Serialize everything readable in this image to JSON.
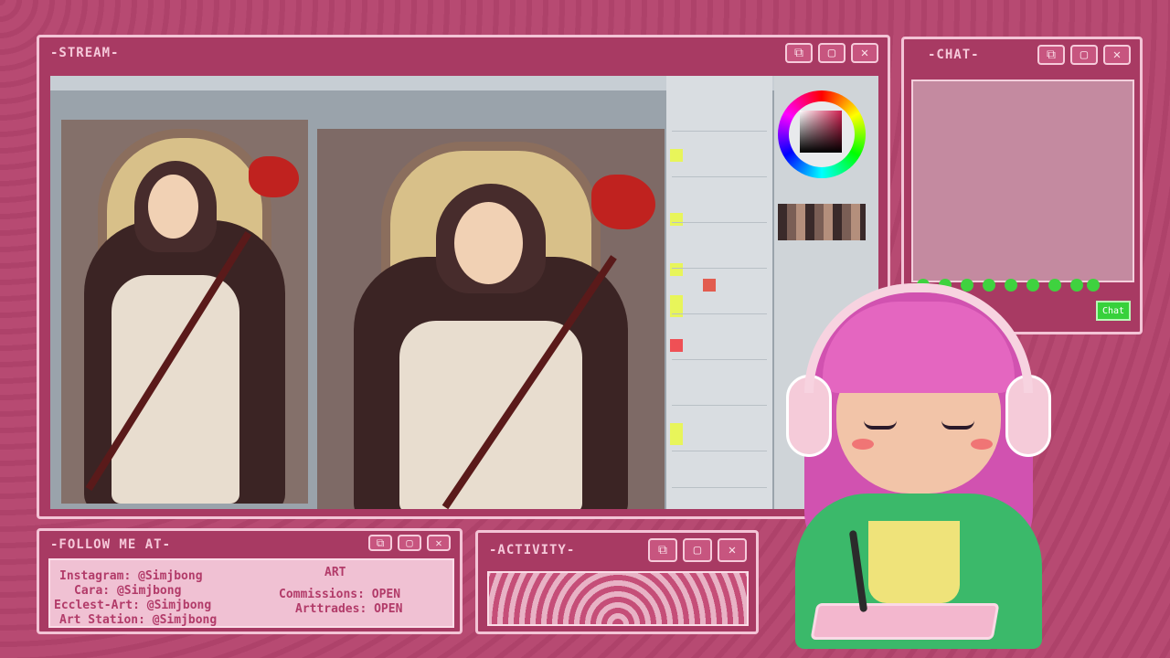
{
  "panels": {
    "stream": {
      "title": "-STREAM-"
    },
    "chat": {
      "title": "-CHAT-",
      "button_label": "Chat"
    },
    "follow": {
      "title": "-FOLLOW ME AT-",
      "heading": "ART",
      "lines": [
        "Instagram: @Simjbong",
        "Cara: @Simjbong",
        "Ecclest-Art: @Simjbong",
        "Art Station: @Simjbong"
      ],
      "commissions": "Commissions: OPEN",
      "arttrades": "Arttrades: OPEN"
    },
    "activity": {
      "title": "-ACTIVITY-"
    }
  },
  "window_buttons": {
    "restore": "⧉",
    "maximize": "▢",
    "close": "✕"
  },
  "colors": {
    "accent": "#b74a72",
    "panel": "#a83a63",
    "border": "#f3c4d6",
    "chat_green": "#37d13b"
  }
}
